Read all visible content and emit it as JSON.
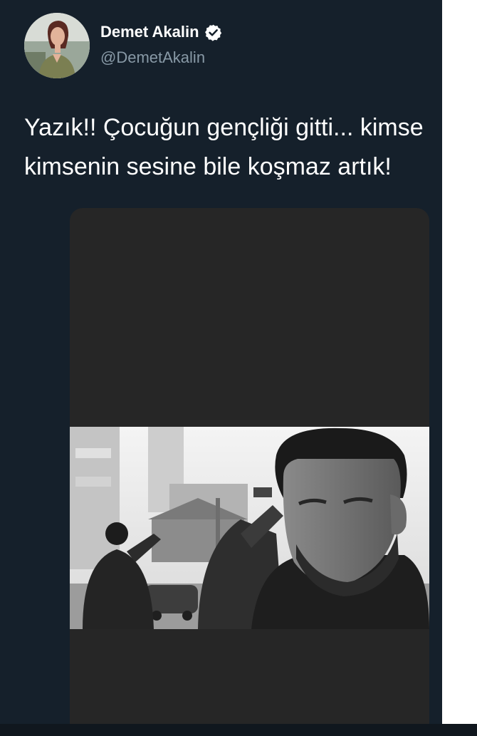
{
  "tweet": {
    "author": {
      "display_name": "Demet Akalin",
      "handle": "@DemetAkalin",
      "verified": true,
      "avatar_icon": "profile-photo",
      "verified_icon": "verified-badge-icon"
    },
    "text_lines": [
      "Yazık!! Çocuğun gençliği gitti... kimse",
      "kimsenin sesine bile koşmaz artık!"
    ],
    "media": {
      "type": "photo",
      "style": "black-and-white"
    }
  },
  "colors": {
    "background": "#15202b",
    "primary_text": "#ffffff",
    "secondary_text": "#8899a6",
    "media_card": "#262626"
  }
}
